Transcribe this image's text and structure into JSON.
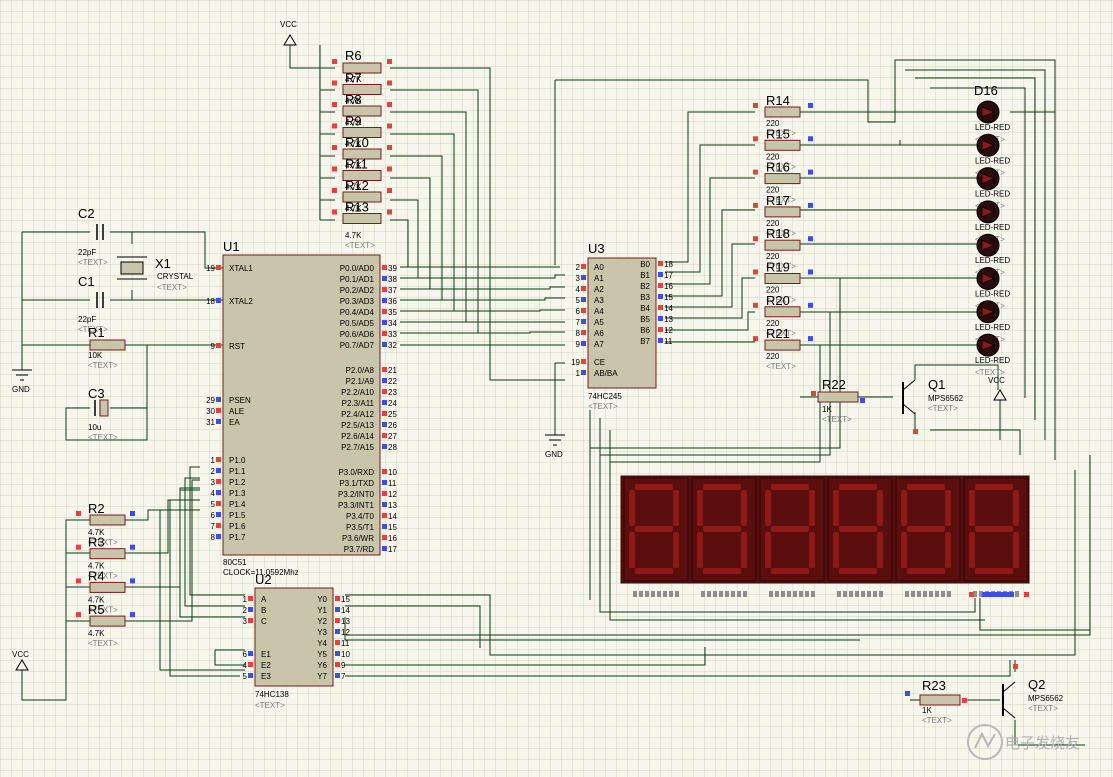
{
  "supply": {
    "vcc": "VCC",
    "gnd": "GND",
    "text_placeholder": "<TEXT>"
  },
  "crystal": {
    "c2": {
      "ref": "C2",
      "value": "22pF"
    },
    "c1": {
      "ref": "C1",
      "value": "22pF"
    },
    "x1": {
      "ref": "X1",
      "value": "CRYSTAL"
    }
  },
  "reset": {
    "r1": {
      "ref": "R1",
      "value": "10K"
    },
    "c3": {
      "ref": "C3",
      "value": "10u"
    }
  },
  "mcu": {
    "ref": "U1",
    "part": "80C51",
    "clock": "CLOCK=11.0592Mhz",
    "left_pins": [
      {
        "num": "19",
        "name": "XTAL1"
      },
      {
        "num": "18",
        "name": "XTAL2"
      },
      {
        "num": "9",
        "name": "RST"
      },
      {
        "num": "29",
        "name": "PSEN"
      },
      {
        "num": "30",
        "name": "ALE"
      },
      {
        "num": "31",
        "name": "EA"
      },
      {
        "num": "1",
        "name": "P1.0"
      },
      {
        "num": "2",
        "name": "P1.1"
      },
      {
        "num": "3",
        "name": "P1.2"
      },
      {
        "num": "4",
        "name": "P1.3"
      },
      {
        "num": "5",
        "name": "P1.4"
      },
      {
        "num": "6",
        "name": "P1.5"
      },
      {
        "num": "7",
        "name": "P1.6"
      },
      {
        "num": "8",
        "name": "P1.7"
      }
    ],
    "right_pins": [
      {
        "num": "39",
        "name": "P0.0/AD0"
      },
      {
        "num": "38",
        "name": "P0.1/AD1"
      },
      {
        "num": "37",
        "name": "P0.2/AD2"
      },
      {
        "num": "36",
        "name": "P0.3/AD3"
      },
      {
        "num": "35",
        "name": "P0.4/AD4"
      },
      {
        "num": "34",
        "name": "P0.5/AD5"
      },
      {
        "num": "33",
        "name": "P0.6/AD6"
      },
      {
        "num": "32",
        "name": "P0.7/AD7"
      },
      {
        "num": "21",
        "name": "P2.0/A8"
      },
      {
        "num": "22",
        "name": "P2.1/A9"
      },
      {
        "num": "23",
        "name": "P2.2/A10"
      },
      {
        "num": "24",
        "name": "P2.3/A11"
      },
      {
        "num": "25",
        "name": "P2.4/A12"
      },
      {
        "num": "26",
        "name": "P2.5/A13"
      },
      {
        "num": "27",
        "name": "P2.6/A14"
      },
      {
        "num": "28",
        "name": "P2.7/A15"
      },
      {
        "num": "10",
        "name": "P3.0/RXD"
      },
      {
        "num": "11",
        "name": "P3.1/TXD"
      },
      {
        "num": "12",
        "name": "P3.2/INT0"
      },
      {
        "num": "13",
        "name": "P3.3/INT1"
      },
      {
        "num": "14",
        "name": "P3.4/T0"
      },
      {
        "num": "15",
        "name": "P3.5/T1"
      },
      {
        "num": "16",
        "name": "P3.6/WR"
      },
      {
        "num": "17",
        "name": "P3.7/RD"
      }
    ]
  },
  "pullups": [
    {
      "ref": "R6",
      "value": "4.7K"
    },
    {
      "ref": "R7",
      "value": "4.7K"
    },
    {
      "ref": "R8",
      "value": "4.7K"
    },
    {
      "ref": "R9",
      "value": "4.7K"
    },
    {
      "ref": "R10",
      "value": "4.7K"
    },
    {
      "ref": "R11",
      "value": "4.7K"
    },
    {
      "ref": "R12",
      "value": "4.7K"
    },
    {
      "ref": "R13",
      "value": "4.7K"
    }
  ],
  "keys": [
    {
      "ref": "R2",
      "value": "4.7K"
    },
    {
      "ref": "R3",
      "value": "4.7K"
    },
    {
      "ref": "R4",
      "value": "4.7K"
    },
    {
      "ref": "R5",
      "value": "4.7K"
    }
  ],
  "decoder": {
    "ref": "U2",
    "part": "74HC138",
    "left_pins": [
      {
        "num": "1",
        "name": "A"
      },
      {
        "num": "2",
        "name": "B"
      },
      {
        "num": "3",
        "name": "C"
      },
      {
        "num": "6",
        "name": "E1"
      },
      {
        "num": "4",
        "name": "E2"
      },
      {
        "num": "5",
        "name": "E3"
      }
    ],
    "right_pins": [
      {
        "num": "15",
        "name": "Y0"
      },
      {
        "num": "14",
        "name": "Y1"
      },
      {
        "num": "13",
        "name": "Y2"
      },
      {
        "num": "12",
        "name": "Y3"
      },
      {
        "num": "11",
        "name": "Y4"
      },
      {
        "num": "10",
        "name": "Y5"
      },
      {
        "num": "9",
        "name": "Y6"
      },
      {
        "num": "7",
        "name": "Y7"
      }
    ]
  },
  "buffer": {
    "ref": "U3",
    "part": "74HC245",
    "left_pins": [
      {
        "num": "2",
        "name": "A0"
      },
      {
        "num": "3",
        "name": "A1"
      },
      {
        "num": "4",
        "name": "A2"
      },
      {
        "num": "5",
        "name": "A3"
      },
      {
        "num": "6",
        "name": "A4"
      },
      {
        "num": "7",
        "name": "A5"
      },
      {
        "num": "8",
        "name": "A6"
      },
      {
        "num": "9",
        "name": "A7"
      },
      {
        "num": "19",
        "name": "CE"
      },
      {
        "num": "1",
        "name": "AB/BA"
      }
    ],
    "right_pins": [
      {
        "num": "18",
        "name": "B0"
      },
      {
        "num": "17",
        "name": "B1"
      },
      {
        "num": "16",
        "name": "B2"
      },
      {
        "num": "15",
        "name": "B3"
      },
      {
        "num": "14",
        "name": "B4"
      },
      {
        "num": "13",
        "name": "B5"
      },
      {
        "num": "12",
        "name": "B6"
      },
      {
        "num": "11",
        "name": "B7"
      }
    ]
  },
  "led_resistors": [
    {
      "ref": "R14",
      "value": "220"
    },
    {
      "ref": "R15",
      "value": "220"
    },
    {
      "ref": "R16",
      "value": "220"
    },
    {
      "ref": "R17",
      "value": "220"
    },
    {
      "ref": "R18",
      "value": "220"
    },
    {
      "ref": "R19",
      "value": "220"
    },
    {
      "ref": "R20",
      "value": "220"
    },
    {
      "ref": "R21",
      "value": "220"
    }
  ],
  "leds": {
    "ref": "D16",
    "part": "LED-RED",
    "count": 8
  },
  "transistors": {
    "q1": {
      "ref": "Q1",
      "part": "MPS6562"
    },
    "q2": {
      "ref": "Q2",
      "part": "MPS6562"
    },
    "r22": {
      "ref": "R22",
      "value": "1K"
    },
    "r23": {
      "ref": "R23",
      "value": "1K"
    }
  },
  "display": {
    "digits": 6,
    "segment_color": "#8e1a18",
    "background": "#5a0f0e"
  },
  "colors": {
    "wire": "#0c3b14",
    "body": "#c9c5aa",
    "outline": "#7a1a1a",
    "pin_red": "#e8403a",
    "pin_blue": "#3a4fe8",
    "grid": "#d5d5c3"
  },
  "watermark": "电子发烧友"
}
